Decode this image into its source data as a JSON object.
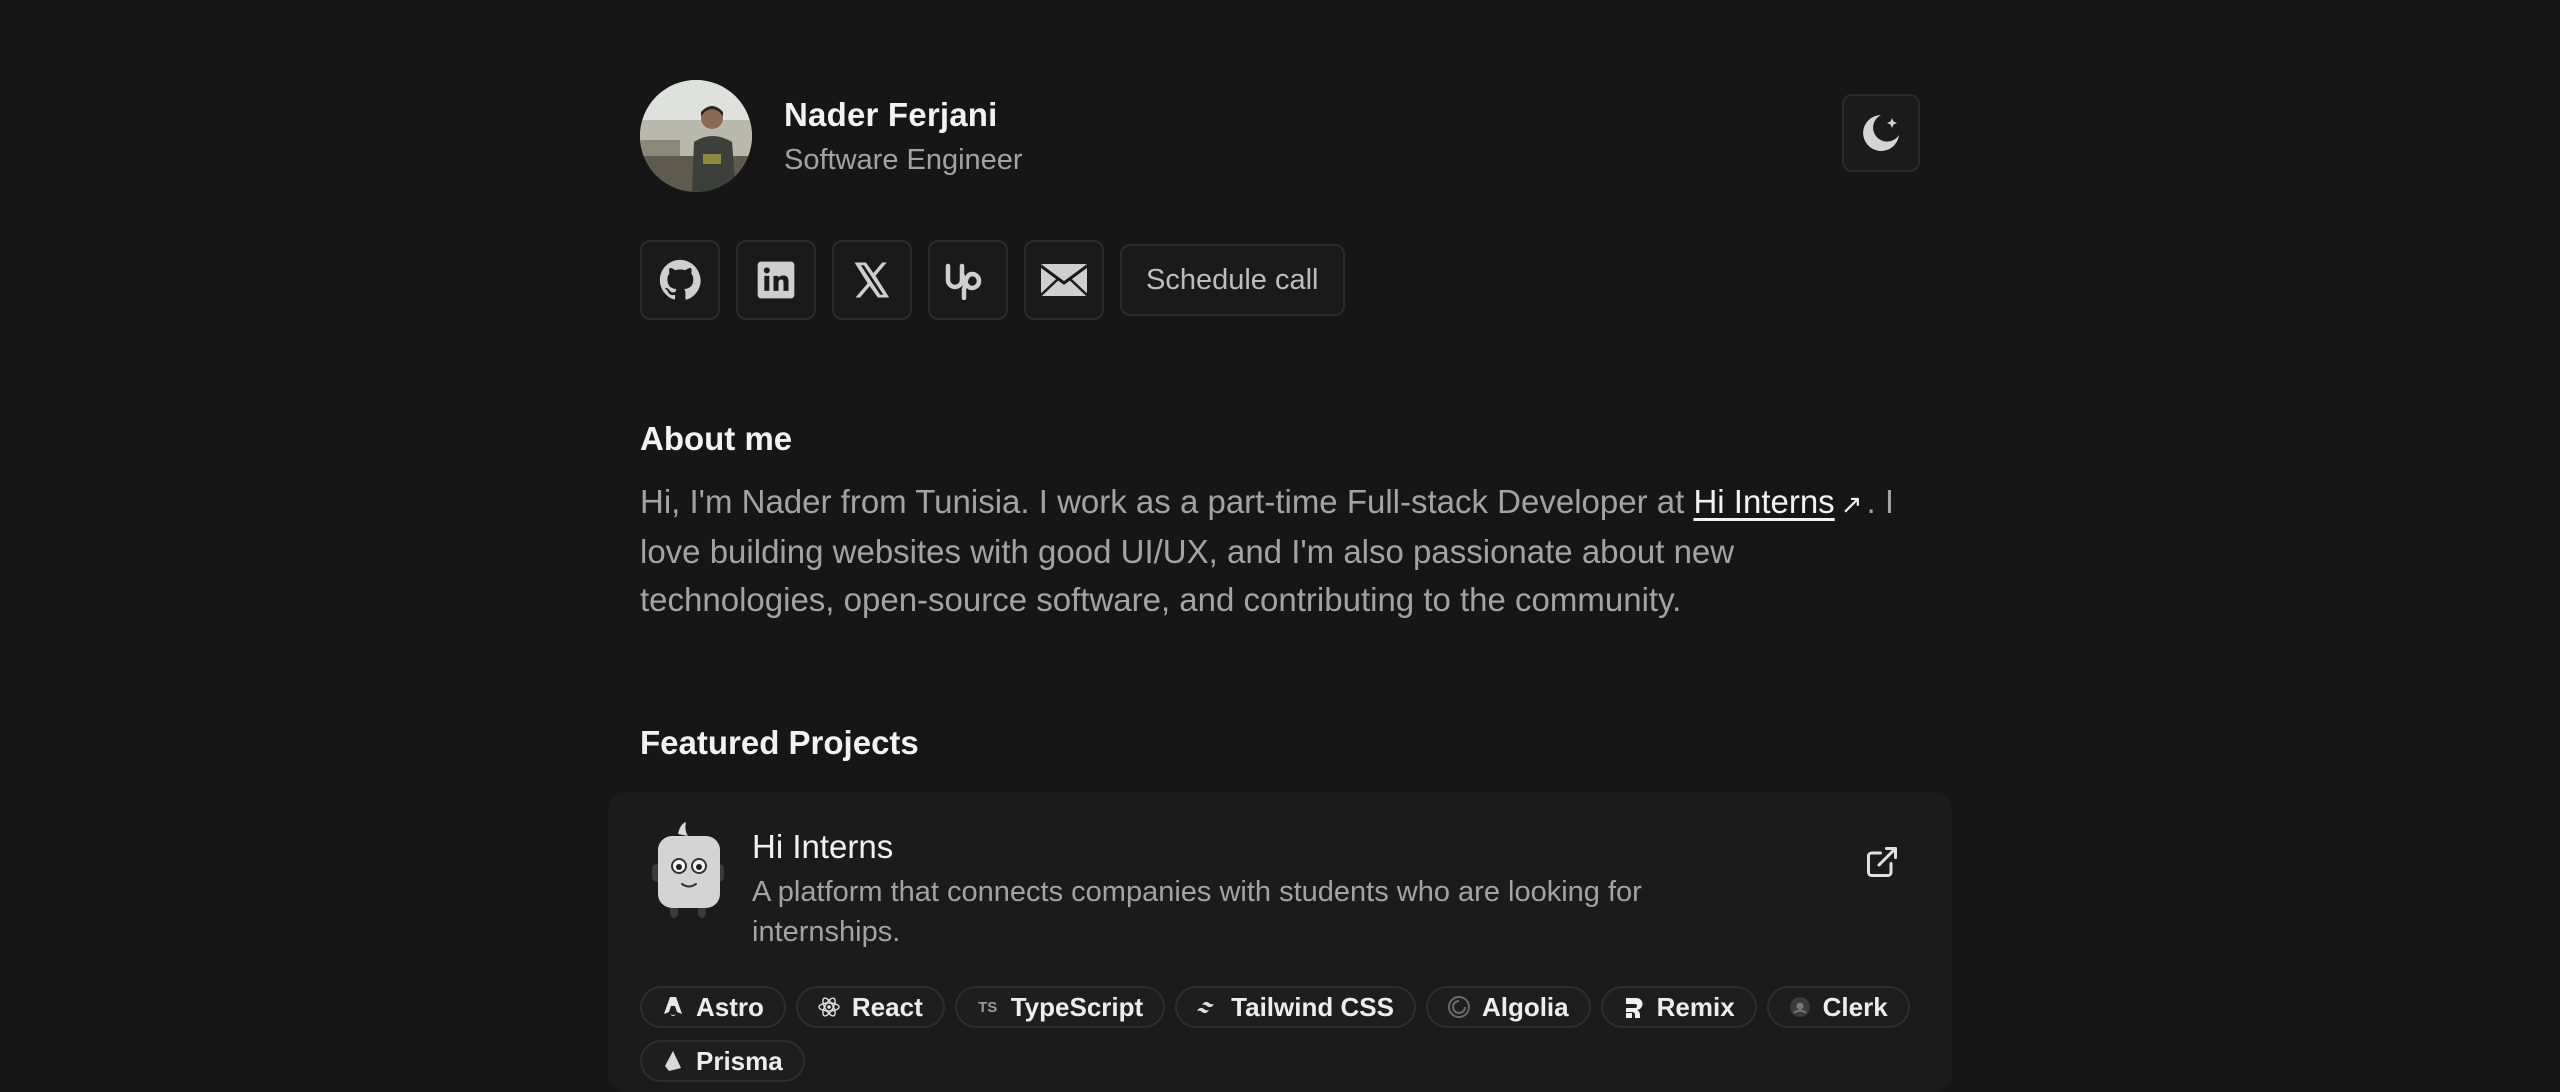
{
  "profile": {
    "name": "Nader Ferjani",
    "role": "Software Engineer"
  },
  "header": {
    "theme_icon": "moon-icon"
  },
  "socials": {
    "items": [
      {
        "name": "github",
        "icon": "github-icon"
      },
      {
        "name": "linkedin",
        "icon": "linkedin-icon"
      },
      {
        "name": "x",
        "icon": "x-icon"
      },
      {
        "name": "upwork",
        "icon": "upwork-icon"
      },
      {
        "name": "email",
        "icon": "mail-icon"
      }
    ],
    "schedule_label": "Schedule call"
  },
  "about": {
    "title": "About me",
    "text_before": "Hi, I'm Nader from Tunisia. I work as a part-time Full-stack Developer at ",
    "link_text": "Hi Interns",
    "text_after": ". I love building websites with good UI/UX, and I'm also passionate about new technologies, open-source software, and contributing to the community."
  },
  "projects": {
    "title": "Featured Projects",
    "items": [
      {
        "name": "Hi Interns",
        "description": "A platform that connects companies with students who are looking for internships.",
        "tags": [
          "Astro",
          "React",
          "TypeScript",
          "Tailwind CSS",
          "Algolia",
          "Remix",
          "Clerk",
          "Prisma"
        ]
      }
    ]
  },
  "colors": {
    "background": "#161616",
    "card": "#1b1b1b",
    "border": "#2c2c2c",
    "text_primary": "#f2f2f2",
    "text_secondary": "#a3a3a3"
  }
}
